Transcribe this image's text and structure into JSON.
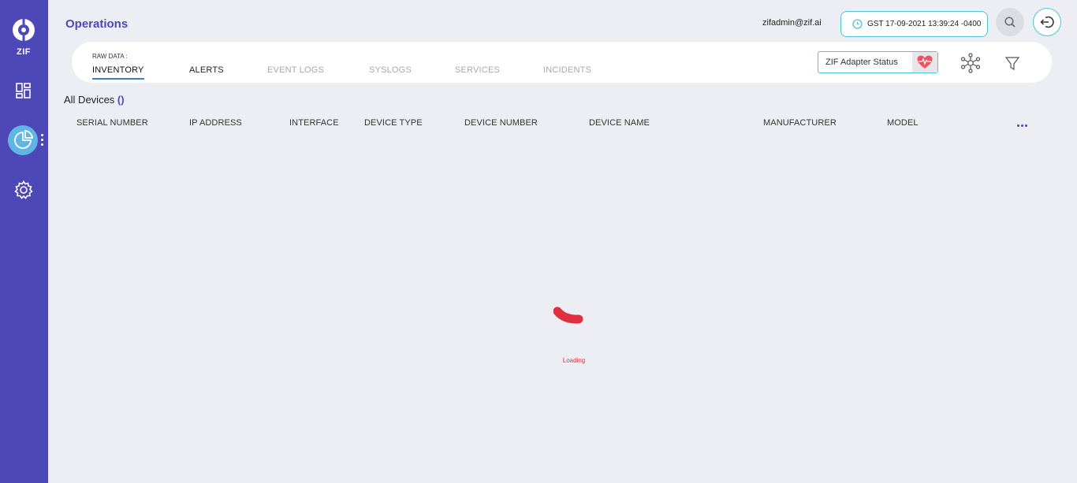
{
  "app": {
    "logo_text": "ZIF",
    "page_title": "Operations"
  },
  "sidebar": {
    "items": [
      {
        "name": "dashboard",
        "icon": "dashboard-grid-icon"
      },
      {
        "name": "operations",
        "icon": "pie-chart-icon",
        "active": true
      },
      {
        "name": "settings",
        "icon": "gear-icon"
      }
    ]
  },
  "header": {
    "user": "zifadmin@zif.ai",
    "clock": "GST 17-09-2021 13:39:24 -0400",
    "search_icon": "search-icon",
    "logout_icon": "logout-icon"
  },
  "tabbar": {
    "raw_data_label": "RAW DATA :",
    "tabs": [
      {
        "label": "INVENTORY",
        "state": "active"
      },
      {
        "label": "ALERTS",
        "state": "normal"
      },
      {
        "label": "EVENT LOGS",
        "state": "muted"
      },
      {
        "label": "SYSLOGS",
        "state": "muted"
      },
      {
        "label": "SERVICES",
        "state": "muted"
      },
      {
        "label": "INCIDENTS",
        "state": "muted"
      }
    ],
    "adapter_status_label": "ZIF Adapter Status",
    "adapter_icon": "heart-pulse-icon",
    "topology_icon": "network-topology-icon",
    "filter_icon": "filter-icon"
  },
  "devices": {
    "title": "All Devices",
    "count": "()",
    "columns": [
      "SERIAL NUMBER",
      "IP ADDRESS",
      "INTERFACE",
      "DEVICE TYPE",
      "DEVICE NUMBER",
      "DEVICE NAME",
      "MANUFACTURER",
      "MODEL"
    ],
    "more_icon": "more-horizontal-icon"
  },
  "loader": {
    "text": "Loading"
  },
  "colors": {
    "sidebar": "#4d47b8",
    "accent": "#4cc7d6",
    "loader": "#e0303f",
    "background": "#eceef3"
  }
}
